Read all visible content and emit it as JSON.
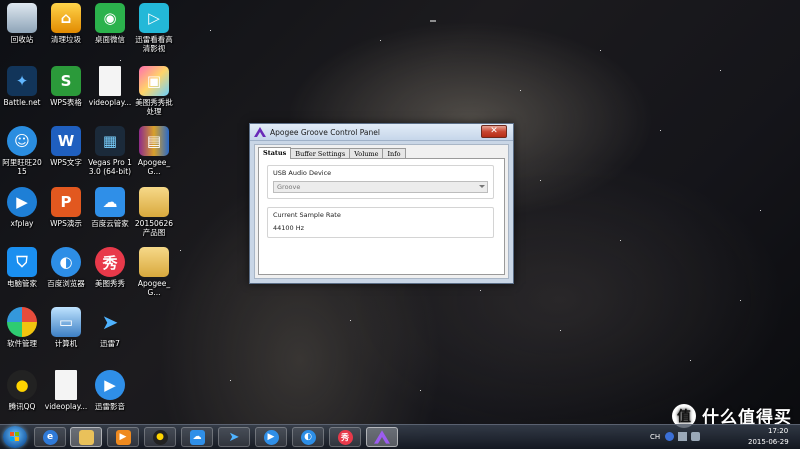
{
  "desktop": {
    "icons": [
      {
        "label": "回收站"
      },
      {
        "label": "清理垃圾"
      },
      {
        "label": "桌面微信"
      },
      {
        "label": "迅雷看看高清影视"
      },
      {
        "label": "Battle.net"
      },
      {
        "label": "WPS表格"
      },
      {
        "label": "videoplay..."
      },
      {
        "label": "美图秀秀批处理"
      },
      {
        "label": "阿里旺旺2015"
      },
      {
        "label": "WPS文字"
      },
      {
        "label": "Vegas Pro 13.0 (64-bit)"
      },
      {
        "label": "Apogee_G..."
      },
      {
        "label": "xfplay"
      },
      {
        "label": "WPS演示"
      },
      {
        "label": "百度云管家"
      },
      {
        "label": "20150626产品图"
      },
      {
        "label": "电脑管家"
      },
      {
        "label": "百度浏览器"
      },
      {
        "label": "美图秀秀"
      },
      {
        "label": "Apogee_G..."
      },
      {
        "label": "软件管理"
      },
      {
        "label": "计算机"
      },
      {
        "label": "迅雷7"
      },
      {
        "label": "腾讯QQ"
      },
      {
        "label": "videoplay..."
      },
      {
        "label": "迅雷影音"
      }
    ]
  },
  "dialog": {
    "title": "Apogee Groove Control Panel",
    "close_label": "✕",
    "tabs": [
      "Status",
      "Buffer Settings",
      "Volume",
      "Info"
    ],
    "usb_group_label": "USB Audio Device",
    "device_value": "Groove",
    "rate_group_label": "Current Sample Rate",
    "rate_value": "44100 Hz"
  },
  "tray": {
    "lang": "CH",
    "time": "17:20",
    "date": "2015-06-29"
  },
  "watermark": {
    "mark": "值",
    "text": "什么值得买"
  },
  "colors": {
    "accent": "#1b5fa8",
    "close": "#c84631",
    "dialog_frame": "#c9d6e6"
  }
}
